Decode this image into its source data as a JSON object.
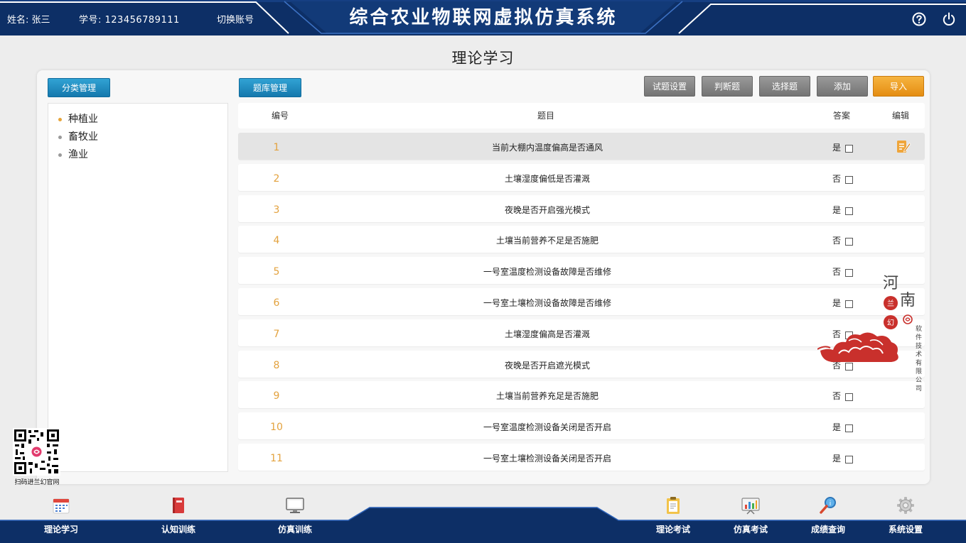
{
  "header": {
    "name_text": "姓名: 张三",
    "id_text": "学号: 123456789111",
    "switch_label": "切换账号",
    "title": "综合农业物联网虚拟仿真系统"
  },
  "page_title": "理论学习",
  "tabs": {
    "category": "分类管理",
    "bank": "题库管理"
  },
  "categories": [
    {
      "label": "种植业",
      "active": true
    },
    {
      "label": "畜牧业",
      "active": false
    },
    {
      "label": "渔业",
      "active": false
    }
  ],
  "toolbar": {
    "setting": "试题设置",
    "judge": "判断题",
    "choice": "选择题",
    "add": "添加",
    "import": "导入"
  },
  "table": {
    "headers": {
      "no": "编号",
      "question": "题目",
      "answer": "答案",
      "edit": "编辑"
    },
    "rows": [
      {
        "no": "1",
        "question": "当前大棚内温度偏高是否通风",
        "answer": "是"
      },
      {
        "no": "2",
        "question": "土壤湿度偏低是否灌溉",
        "answer": "否"
      },
      {
        "no": "3",
        "question": "夜晚是否开启强光模式",
        "answer": "是"
      },
      {
        "no": "4",
        "question": "土壤当前营养不足是否施肥",
        "answer": "否"
      },
      {
        "no": "5",
        "question": "一号室温度检测设备故障是否维修",
        "answer": "否"
      },
      {
        "no": "6",
        "question": "一号室土壤检测设备故障是否维修",
        "answer": "是"
      },
      {
        "no": "7",
        "question": "土壤湿度偏高是否灌溉",
        "answer": "否"
      },
      {
        "no": "8",
        "question": "夜晚是否开启遮光模式",
        "answer": "否"
      },
      {
        "no": "9",
        "question": "土壤当前营养充足是否施肥",
        "answer": "否"
      },
      {
        "no": "10",
        "question": "一号室温度检测设备关闭是否开启",
        "answer": "是"
      },
      {
        "no": "11",
        "question": "一号室土壤检测设备关闭是否开启",
        "answer": "是"
      }
    ],
    "selected_row": "1"
  },
  "watermark": {
    "char1": "河",
    "char2": "南",
    "small": "软件技术有限公司"
  },
  "qr_caption": "扫码进兰幻官网",
  "bottom_nav": [
    {
      "label": "理论学习",
      "icon": "calendar-icon"
    },
    {
      "label": "认知训练",
      "icon": "book-icon"
    },
    {
      "label": "仿真训练",
      "icon": "monitor-icon"
    },
    {
      "label": "理论考试",
      "icon": "clipboard-icon"
    },
    {
      "label": "仿真考试",
      "icon": "chart-board-icon"
    },
    {
      "label": "成绩查询",
      "icon": "magnifier-icon"
    },
    {
      "label": "系统设置",
      "icon": "gear-icon"
    }
  ],
  "colors": {
    "navy": "#0d2f66",
    "accent_blue": "#1a85bb",
    "import_orange": "#f0a22a",
    "row_number": "#e3a23e"
  }
}
